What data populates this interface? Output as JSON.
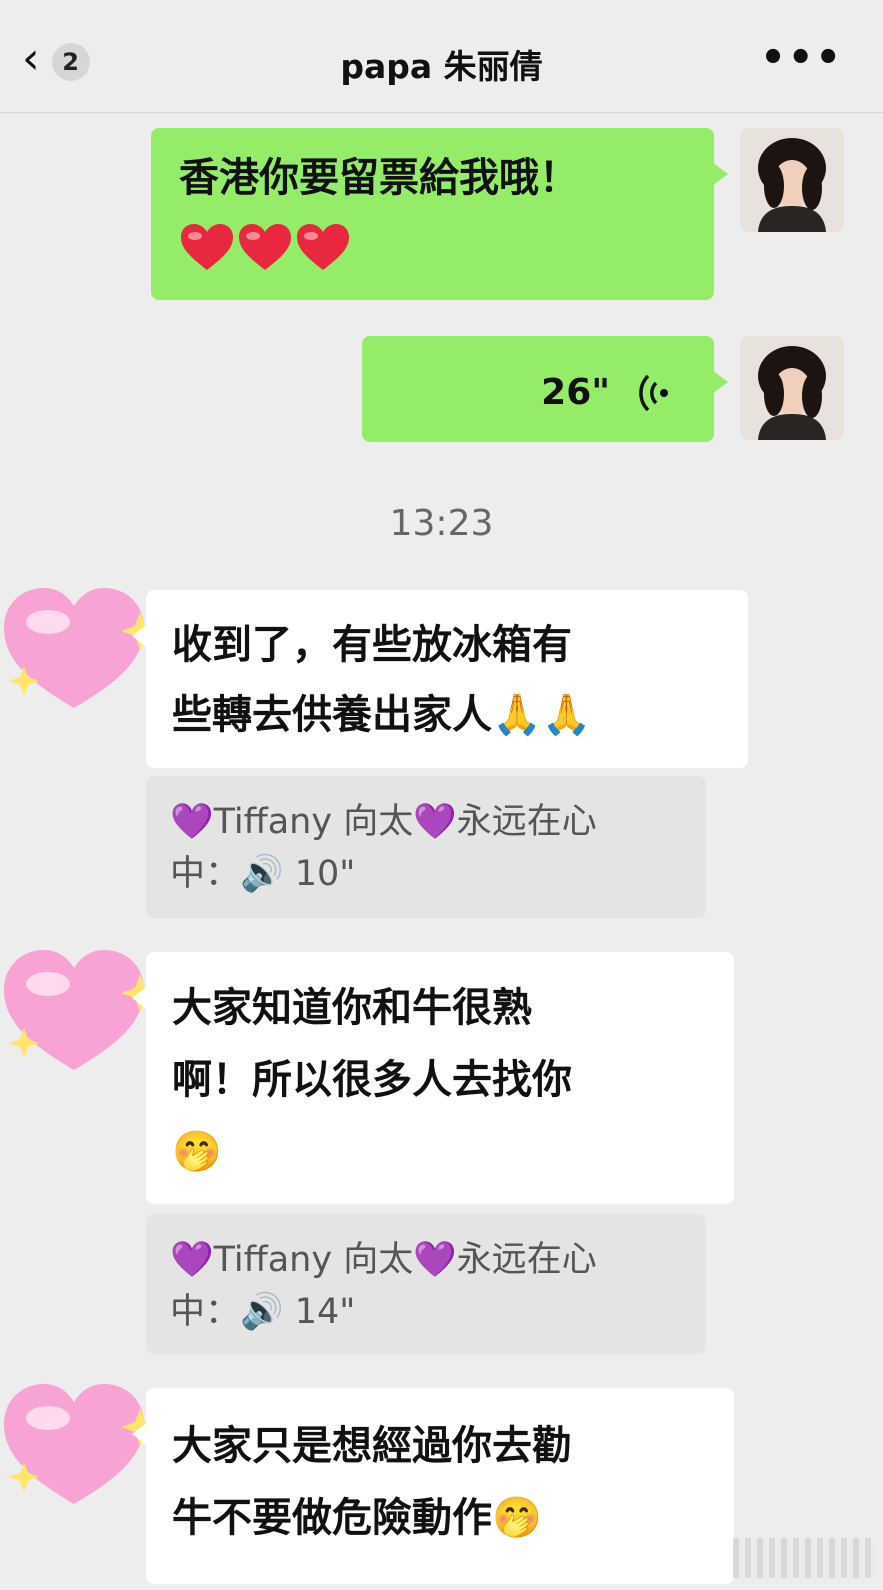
{
  "header": {
    "back_count": "2",
    "title": "papa 朱丽倩",
    "more": "•••"
  },
  "messages": {
    "sent_text_line1": "香港你要留票給我哦！",
    "sent_voice_duration": "26\"",
    "timestamp": "13:23",
    "reply1_line1": "收到了，有些放冰箱有",
    "reply1_line2": "些轉去供養出家人🙏🙏",
    "quote1_line1": "💜Tiffany 向太💜永远在心",
    "quote1_line2": "中：🔊 10\"",
    "reply2_line1": "大家知道你和牛很熟",
    "reply2_line2": "啊！所以很多人去找你",
    "reply2_line3": "🤭",
    "quote2_line1": "💜Tiffany 向太💜永远在心",
    "quote2_line2": "中：🔊 14\"",
    "reply3_line1": "大家只是想經過你去勸",
    "reply3_line2": "牛不要做危險動作🤭"
  },
  "colors": {
    "sent_bubble": "#95ec69",
    "received_bubble": "#ffffff",
    "background": "#ededed",
    "quote_background": "#e4e4e4"
  },
  "icons": {
    "back": "chevron-left-icon",
    "more": "ellipsis-icon",
    "voice": "voice-wave-icon",
    "heart": "red-heart-icon",
    "sender_avatar": "pink-heart-sparkle-icon"
  }
}
